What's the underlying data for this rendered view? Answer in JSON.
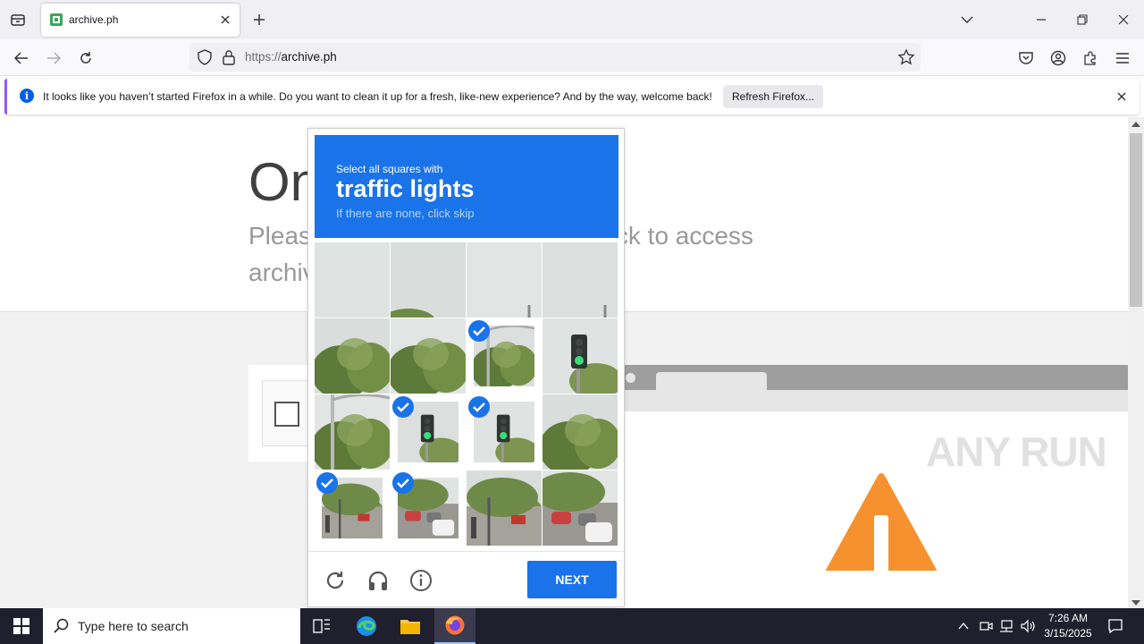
{
  "browser": {
    "tab_title": "archive.ph",
    "url_scheme": "https://",
    "url_host": "archive.ph"
  },
  "notification": {
    "message": "It looks like you haven’t started Firefox in a while. Do you want to clean it up for a fresh, like-new experience? And by the way, welcome back!",
    "button_label": "Refresh Firefox..."
  },
  "page": {
    "heading": "One more step",
    "paragraph": "Please complete the security check to access archive.ph"
  },
  "captcha": {
    "prompt_small": "Select all squares with",
    "prompt_target": "traffic lights",
    "prompt_hint": "If there are none, click skip",
    "next_label": "NEXT",
    "grid": [
      [
        false,
        false,
        false,
        false
      ],
      [
        false,
        false,
        true,
        false
      ],
      [
        false,
        true,
        true,
        false
      ],
      [
        true,
        true,
        false,
        false
      ]
    ]
  },
  "watermark": "ANY RUN",
  "taskbar": {
    "search_placeholder": "Type here to search",
    "time": "7:26 AM",
    "date": "3/15/2025"
  }
}
